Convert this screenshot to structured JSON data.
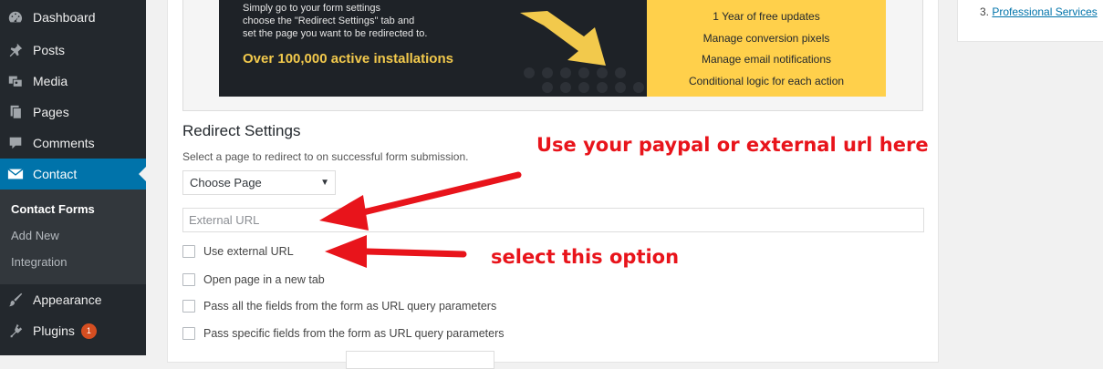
{
  "sidebar": {
    "items": [
      {
        "label": "Dashboard",
        "icon": "dashboard-icon"
      },
      {
        "label": "Posts",
        "icon": "pushpin-icon"
      },
      {
        "label": "Media",
        "icon": "media-icon"
      },
      {
        "label": "Pages",
        "icon": "pages-icon"
      },
      {
        "label": "Comments",
        "icon": "comment-icon"
      },
      {
        "label": "Contact",
        "icon": "mail-icon"
      },
      {
        "label": "Appearance",
        "icon": "paintbrush-icon"
      },
      {
        "label": "Plugins",
        "icon": "plugin-icon",
        "badge": "1"
      }
    ],
    "submenu": [
      "Contact Forms",
      "Add New",
      "Integration"
    ],
    "accent_color": "#0073aa",
    "background_color": "#23282d"
  },
  "banner": {
    "lines": [
      "Simply go to your form settings",
      "choose the \"Redirect Settings\" tab and",
      "set the page you want to be redirected to."
    ],
    "installs": "Over 100,000 active installations",
    "features": [
      "1 Year of free updates",
      "Manage conversion pixels",
      "Manage email notifications",
      "Conditional logic for each action"
    ],
    "accent_color": "#ffd04b"
  },
  "redirect": {
    "title": "Redirect Settings",
    "description": "Select a page to redirect to on successful form submission.",
    "select_value": "Choose Page",
    "url_placeholder": "External URL",
    "options": [
      "Use external URL",
      "Open page in a new tab",
      "Pass all the fields from the form as URL query parameters",
      "Pass specific fields from the form as URL query parameters"
    ]
  },
  "annotations": {
    "top": "Use your paypal or external url here",
    "bottom": "select this option",
    "color": "#e8141b"
  },
  "right_widget": {
    "number": "3.",
    "link": "Professional Services"
  }
}
